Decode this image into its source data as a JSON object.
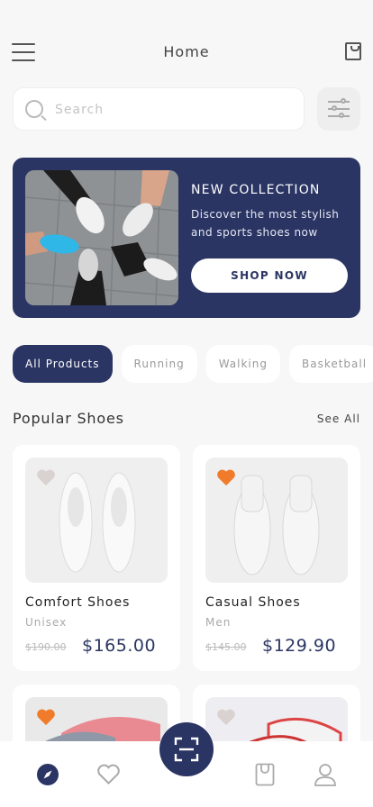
{
  "header": {
    "title": "Home"
  },
  "search": {
    "placeholder": "Search",
    "value": ""
  },
  "banner": {
    "title": "NEW COLLECTION",
    "subtitle": "Discover the most stylish and sports shoes now",
    "button_label": "SHOP NOW"
  },
  "categories": [
    {
      "label": "All Products",
      "active": true
    },
    {
      "label": "Running",
      "active": false
    },
    {
      "label": "Walking",
      "active": false
    },
    {
      "label": "Basketball",
      "active": false
    }
  ],
  "section": {
    "title": "Popular Shoes",
    "see_all": "See All"
  },
  "products": [
    {
      "name": "Comfort Shoes",
      "category": "Unisex",
      "old_price": "$190.00",
      "price": "$165.00",
      "favorite": false
    },
    {
      "name": "Casual Shoes",
      "category": "Men",
      "old_price": "$145.00",
      "price": "$129.90",
      "favorite": true
    },
    {
      "name": "",
      "category": "",
      "old_price": "",
      "price": "",
      "favorite": true
    },
    {
      "name": "",
      "category": "",
      "old_price": "",
      "price": "",
      "favorite": false
    }
  ],
  "colors": {
    "primary": "#2b3563",
    "accent": "#f07c2b",
    "heart_inactive": "#d9d2d0",
    "background": "#f7f7f7"
  },
  "bottom_nav": {
    "items": [
      {
        "icon": "compass-icon",
        "active": true
      },
      {
        "icon": "heart-icon",
        "active": false
      },
      {
        "icon": "scan-icon",
        "active": false
      },
      {
        "icon": "bag-icon",
        "active": false
      },
      {
        "icon": "user-icon",
        "active": false
      }
    ]
  }
}
